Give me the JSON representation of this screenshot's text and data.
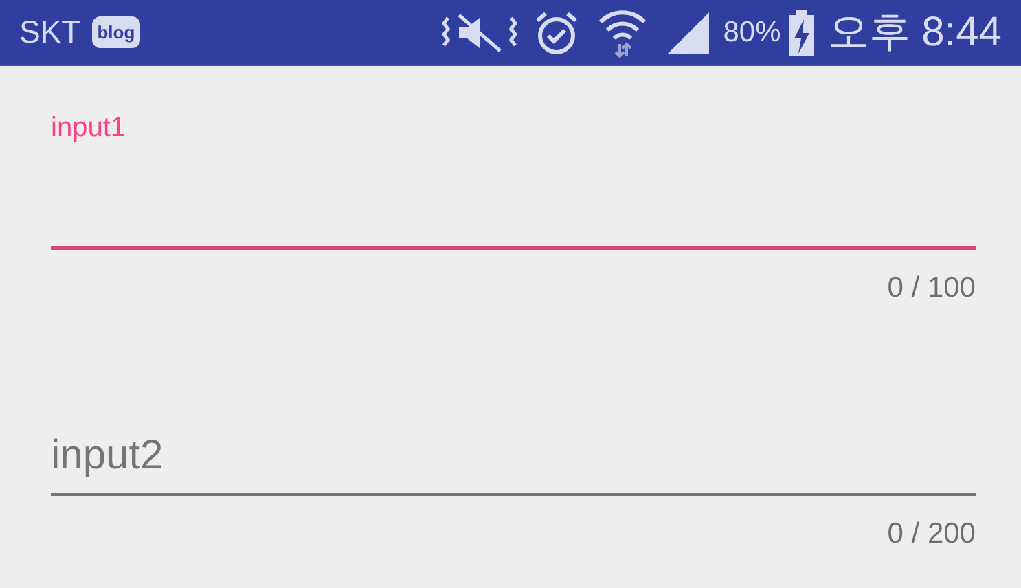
{
  "status_bar": {
    "carrier": "SKT",
    "badge": "blog",
    "battery": "80%",
    "time": "오후 8:44"
  },
  "fields": [
    {
      "label": "input1",
      "focused": true,
      "counter": "0 / 100"
    },
    {
      "label": "input2",
      "focused": false,
      "counter": "0 / 200"
    }
  ]
}
